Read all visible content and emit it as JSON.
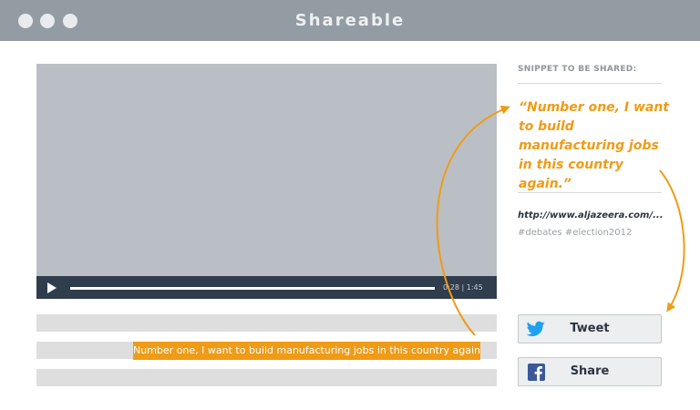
{
  "window": {
    "title": "Shareable"
  },
  "player": {
    "time_current": "0:28",
    "time_separator": "|",
    "time_total": "1:45"
  },
  "transcript": {
    "highlighted_text": "Number one, I want to build manufacturing jobs in this country again."
  },
  "snippet": {
    "label": "SNIPPET TO BE SHARED:",
    "quote": "“Number one, I want to build manufacturing jobs in this country again.”",
    "url": "http://www.aljazeera.com/...",
    "tags": "#debates #election2012"
  },
  "share": {
    "tweet_label": "Tweet",
    "share_label": "Share"
  },
  "colors": {
    "accent": "#f09b16",
    "titlebar": "#939ba3",
    "video": "#babfc6",
    "controls": "#2f3d4d",
    "twitter": "#1da1f2",
    "facebook": "#3b5998"
  }
}
